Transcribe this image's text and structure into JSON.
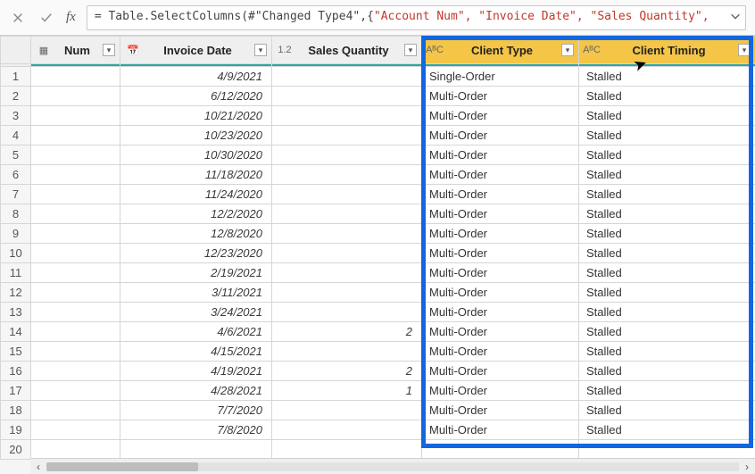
{
  "formula_bar": {
    "prefix": "= Table.SelectColumns(#\"Changed Type4\",{",
    "args": "\"Account Num\", \"Invoice Date\", \"Sales Quantity\","
  },
  "columns": {
    "num": {
      "label": "Num",
      "type_prefix": ""
    },
    "date": {
      "label": "Invoice Date",
      "type_prefix": ""
    },
    "qty": {
      "label": "Sales Quantity",
      "type_prefix": "1.2"
    },
    "ctype": {
      "label": "Client Type",
      "type_prefix": "AᴮC"
    },
    "ctiming": {
      "label": "Client Timing",
      "type_prefix": "AᴮC"
    }
  },
  "rows": [
    {
      "n": "1",
      "date": "4/9/2021",
      "qty": "",
      "ctype": "Single-Order",
      "ctiming": "Stalled"
    },
    {
      "n": "2",
      "date": "6/12/2020",
      "qty": "",
      "ctype": "Multi-Order",
      "ctiming": "Stalled"
    },
    {
      "n": "3",
      "date": "10/21/2020",
      "qty": "",
      "ctype": "Multi-Order",
      "ctiming": "Stalled"
    },
    {
      "n": "4",
      "date": "10/23/2020",
      "qty": "",
      "ctype": "Multi-Order",
      "ctiming": "Stalled"
    },
    {
      "n": "5",
      "date": "10/30/2020",
      "qty": "",
      "ctype": "Multi-Order",
      "ctiming": "Stalled"
    },
    {
      "n": "6",
      "date": "11/18/2020",
      "qty": "",
      "ctype": "Multi-Order",
      "ctiming": "Stalled"
    },
    {
      "n": "7",
      "date": "11/24/2020",
      "qty": "",
      "ctype": "Multi-Order",
      "ctiming": "Stalled"
    },
    {
      "n": "8",
      "date": "12/2/2020",
      "qty": "",
      "ctype": "Multi-Order",
      "ctiming": "Stalled"
    },
    {
      "n": "9",
      "date": "12/8/2020",
      "qty": "",
      "ctype": "Multi-Order",
      "ctiming": "Stalled"
    },
    {
      "n": "10",
      "date": "12/23/2020",
      "qty": "",
      "ctype": "Multi-Order",
      "ctiming": "Stalled"
    },
    {
      "n": "11",
      "date": "2/19/2021",
      "qty": "",
      "ctype": "Multi-Order",
      "ctiming": "Stalled"
    },
    {
      "n": "12",
      "date": "3/11/2021",
      "qty": "",
      "ctype": "Multi-Order",
      "ctiming": "Stalled"
    },
    {
      "n": "13",
      "date": "3/24/2021",
      "qty": "",
      "ctype": "Multi-Order",
      "ctiming": "Stalled"
    },
    {
      "n": "14",
      "date": "4/6/2021",
      "qty": "2",
      "ctype": "Multi-Order",
      "ctiming": "Stalled"
    },
    {
      "n": "15",
      "date": "4/15/2021",
      "qty": "",
      "ctype": "Multi-Order",
      "ctiming": "Stalled"
    },
    {
      "n": "16",
      "date": "4/19/2021",
      "qty": "2",
      "ctype": "Multi-Order",
      "ctiming": "Stalled"
    },
    {
      "n": "17",
      "date": "4/28/2021",
      "qty": "1",
      "ctype": "Multi-Order",
      "ctiming": "Stalled"
    },
    {
      "n": "18",
      "date": "7/7/2020",
      "qty": "",
      "ctype": "Multi-Order",
      "ctiming": "Stalled"
    },
    {
      "n": "19",
      "date": "7/8/2020",
      "qty": "",
      "ctype": "Multi-Order",
      "ctiming": "Stalled"
    },
    {
      "n": "20",
      "date": "",
      "qty": "",
      "ctype": "",
      "ctiming": ""
    }
  ]
}
